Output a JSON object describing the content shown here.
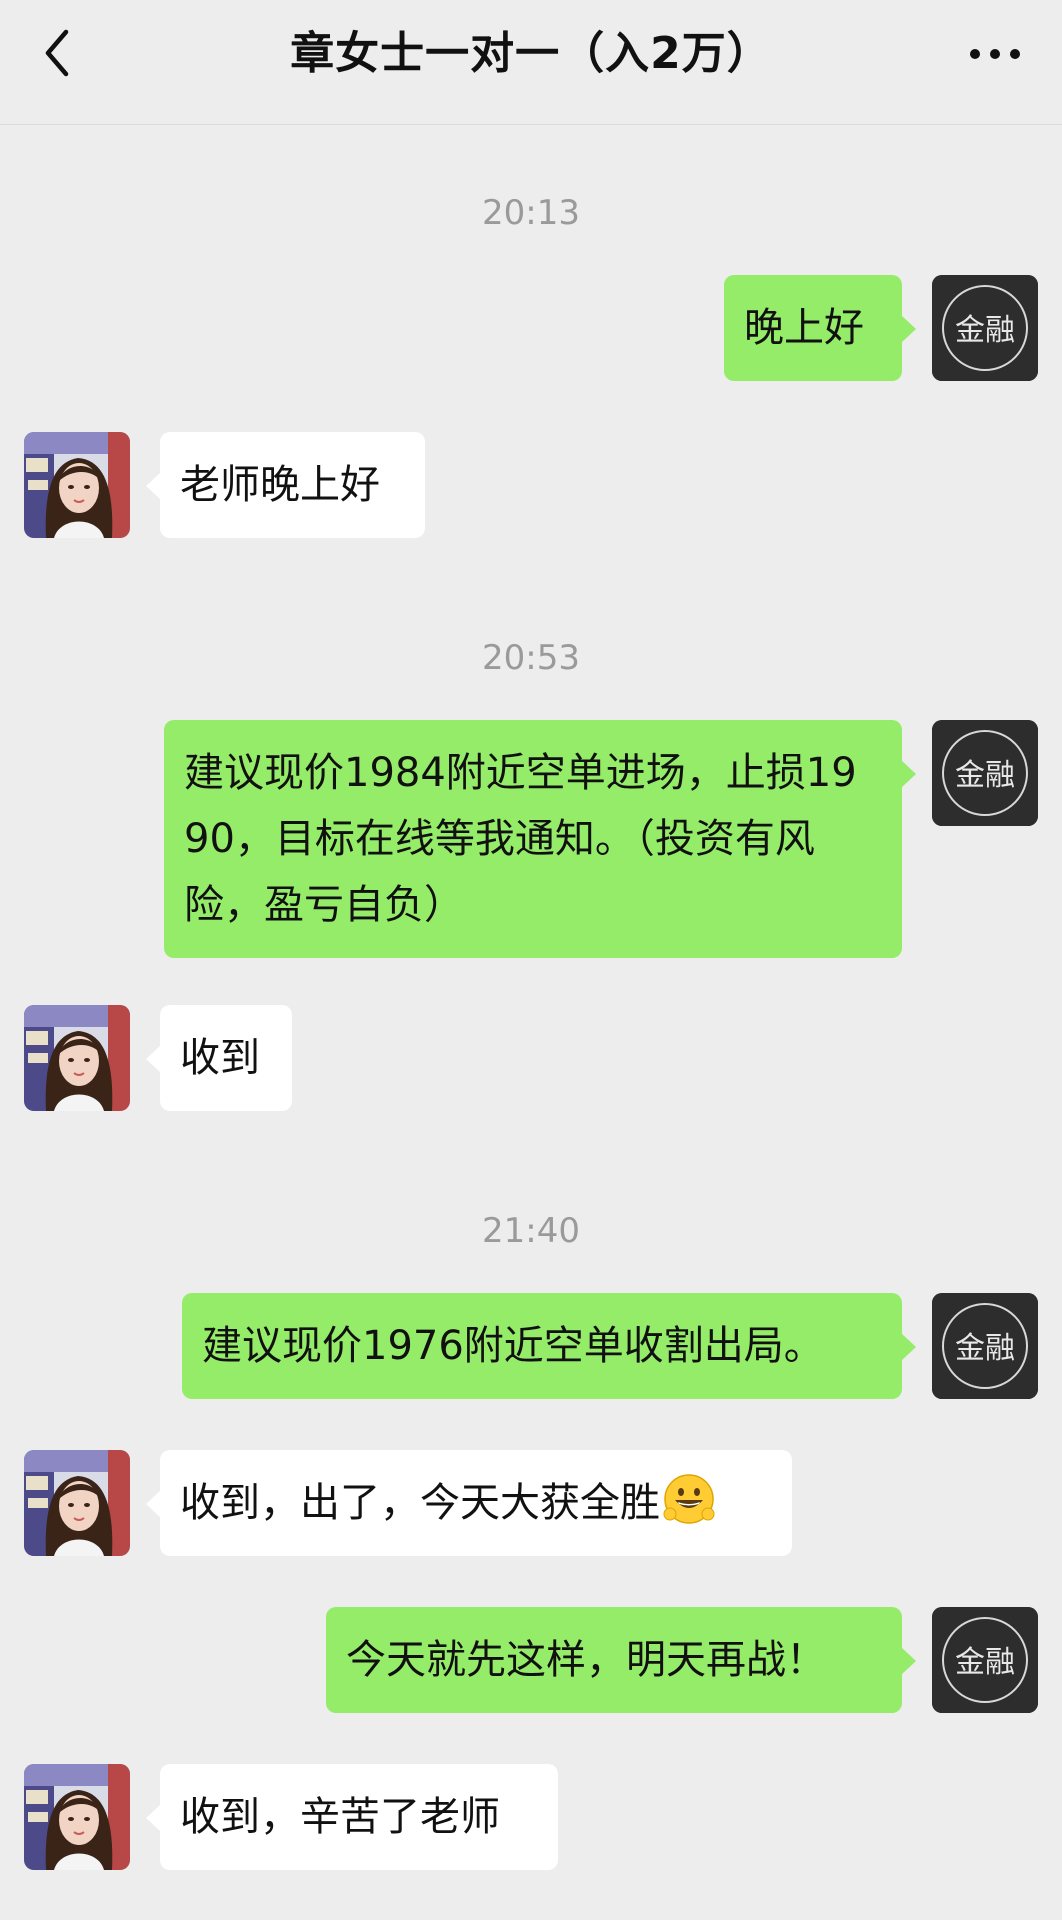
{
  "header": {
    "title": "章女士一对一（入2万）",
    "back_icon": "chevron-left-icon",
    "more_icon": "more-dots-icon"
  },
  "brand_avatar_text": "金融",
  "times": [
    "20:13",
    "20:53",
    "21:40"
  ],
  "messages": [
    {
      "side": "right",
      "text": "晚上好"
    },
    {
      "side": "left",
      "text": "老师晚上好"
    },
    {
      "side": "right",
      "text": "建议现价1984附近空单进场，止损1990，目标在线等我通知。（投资有风险，盈亏自负）"
    },
    {
      "side": "left",
      "text": "收到"
    },
    {
      "side": "right",
      "text": "建议现价1976附近空单收割出局。"
    },
    {
      "side": "left",
      "text": "收到，出了，今天大获全胜",
      "emoji": "grinning-face-emoji"
    },
    {
      "side": "right",
      "text": "今天就先这样，明天再战！"
    },
    {
      "side": "left",
      "text": "收到，辛苦了老师"
    }
  ],
  "colors": {
    "background": "#ededed",
    "sent_bubble": "#95ec69",
    "received_bubble": "#ffffff",
    "timestamp": "#9a9a9a"
  }
}
